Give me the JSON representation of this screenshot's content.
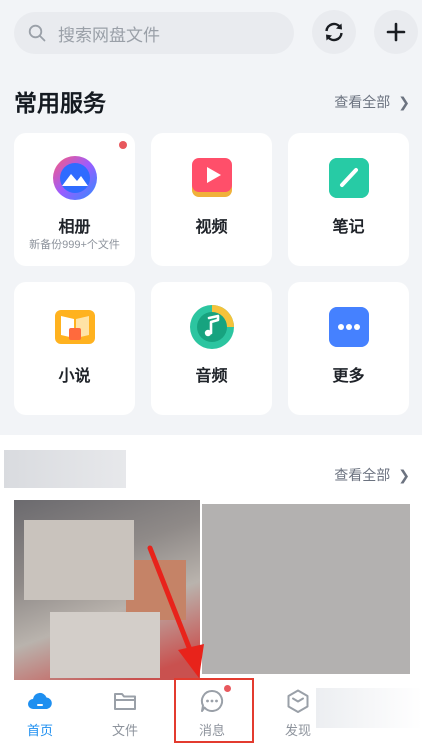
{
  "search": {
    "placeholder": "搜索网盘文件"
  },
  "services": {
    "title": "常用服务",
    "see_all": "查看全部",
    "items": [
      {
        "label": "相册",
        "sub": "新备份999+个文件",
        "icon": "album-icon",
        "badge": true
      },
      {
        "label": "视频",
        "sub": "",
        "icon": "video-icon",
        "badge": false
      },
      {
        "label": "笔记",
        "sub": "",
        "icon": "note-icon",
        "badge": false
      },
      {
        "label": "小说",
        "sub": "",
        "icon": "novel-icon",
        "badge": false
      },
      {
        "label": "音频",
        "sub": "",
        "icon": "audio-icon",
        "badge": false
      },
      {
        "label": "更多",
        "sub": "",
        "icon": "more-icon",
        "badge": false
      }
    ]
  },
  "photos": {
    "see_all": "查看全部"
  },
  "nav": [
    {
      "label": "首页",
      "icon": "home-cloud-icon",
      "active": true
    },
    {
      "label": "文件",
      "icon": "folder-icon",
      "active": false
    },
    {
      "label": "消息",
      "icon": "message-icon",
      "active": false,
      "badge": true
    },
    {
      "label": "发现",
      "icon": "discover-icon",
      "active": false
    }
  ],
  "colors": {
    "accent": "#1e8ff0",
    "badge": "#e8585d",
    "highlight": "#e33b2f"
  }
}
